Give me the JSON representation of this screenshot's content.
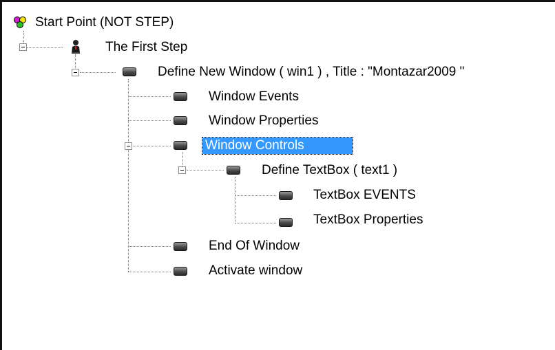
{
  "tree": {
    "nodes": [
      {
        "label": "Start Point (NOT STEP)",
        "icon": "start-point-icon"
      },
      {
        "label": "The First Step",
        "icon": "person-icon"
      },
      {
        "label": "Define New Window  ( win1 ) , Title : \"Montazar2009  \"",
        "icon": "window-icon"
      },
      {
        "label": "Window Events",
        "icon": "window-icon"
      },
      {
        "label": "Window Properties",
        "icon": "window-icon"
      },
      {
        "label": "Window Controls",
        "icon": "window-icon",
        "selected": true
      },
      {
        "label": "Define TextBox  ( text1  )",
        "icon": "window-icon"
      },
      {
        "label": "TextBox EVENTS",
        "icon": "window-icon"
      },
      {
        "label": "TextBox Properties",
        "icon": "window-icon"
      },
      {
        "label": "End Of Window",
        "icon": "window-icon"
      },
      {
        "label": "Activate window",
        "icon": "window-icon"
      }
    ]
  },
  "colors": {
    "selection": "#3399ff"
  }
}
